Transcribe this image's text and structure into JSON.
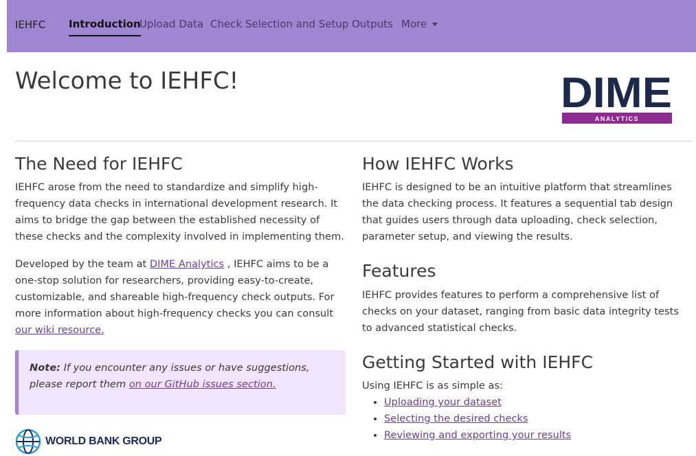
{
  "navbar": {
    "brand": "IEHFC",
    "items": [
      {
        "label": "Introduction",
        "active": true
      },
      {
        "label": "Upload Data"
      },
      {
        "label": "Check Selection and Setup"
      },
      {
        "label": "Outputs"
      },
      {
        "label": "More"
      }
    ]
  },
  "page": {
    "title": "Welcome to IEHFC!"
  },
  "logos": {
    "dime_main": "DIME",
    "dime_sub": "ANALYTICS",
    "world_bank": "WORLD BANK GROUP"
  },
  "left": {
    "heading": "The Need for IEHFC",
    "p1": "IEHFC arose from the need to standardize and simplify high-frequency data checks in international development research. It aims to bridge the gap between the established necessity of these checks and the complexity involved in implementing them.",
    "p2_before": "Developed by the team at ",
    "p2_link": "DIME Analytics",
    "p2_middle": " , IEHFC aims to be a one-stop solution for researchers, providing easy-to-create, customizable, and shareable high-frequency check outputs. For more information about high-frequency checks you can consult ",
    "p2_link2": "our wiki resource.",
    "note_label": "Note:",
    "note_text": " If you encounter any issues or have suggestions, please report them ",
    "note_link": "on our GitHub issues section."
  },
  "right": {
    "how_heading": "How IEHFC Works",
    "how_text": "IEHFC is designed to be an intuitive platform that streamlines the data checking process. It features a sequential tab design that guides users through data uploading, check selection, parameter setup, and viewing the results.",
    "features_heading": "Features",
    "features_text": "IEHFC provides features to perform a comprehensive list of checks on your dataset, ranging from basic data integrity tests to advanced statistical checks.",
    "start_heading": "Getting Started with IEHFC",
    "start_intro": "Using IEHFC is as simple as:",
    "steps": [
      "Uploading your dataset",
      "Selecting the desired checks",
      "Reviewing and exporting your results"
    ]
  },
  "colors": {
    "navbar": "#a086d0",
    "note_bg": "#f2e4fd",
    "link": "#6a3d9a",
    "dime_navy": "#1b2a4a",
    "dime_purple": "#8e2b8e"
  }
}
